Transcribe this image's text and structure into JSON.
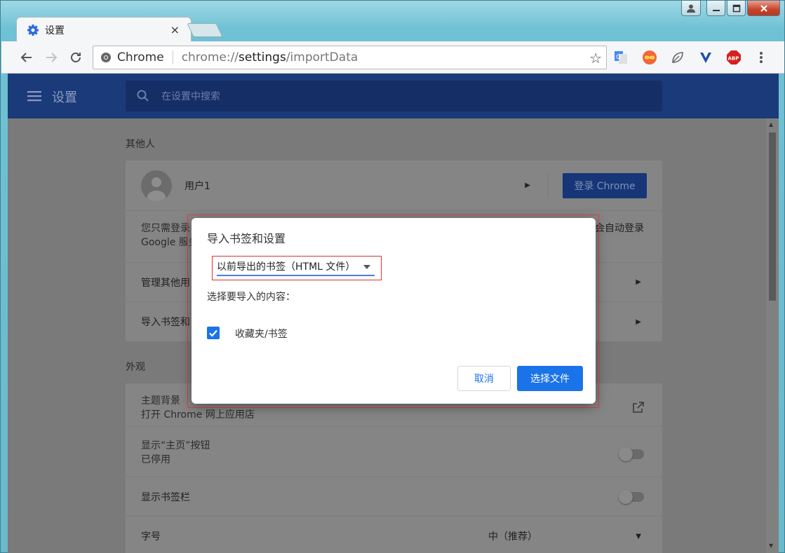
{
  "browser": {
    "tab_title": "设置",
    "tab_close": "×",
    "omnibox_chip": "Chrome",
    "url_scheme": "chrome://",
    "url_host": "settings",
    "url_path": "/importData"
  },
  "settings_header": {
    "title": "设置",
    "search_placeholder": "在设置中搜索"
  },
  "people_section": {
    "title": "其他人",
    "user_name": "用户1",
    "signin_button": "登录 Chrome",
    "sync_text_left_line1": "您只需登录",
    "sync_text_left_line2": "Google 服务",
    "sync_text_right": "会自动登录",
    "manage_label": "管理其他用",
    "import_label": "导入书签和"
  },
  "appearance_section": {
    "title": "外观",
    "theme_label": "主题背景",
    "theme_sub": "打开 Chrome 网上应用店",
    "home_label": "显示“主页”按钮",
    "home_sub": "已停用",
    "bookmarks_bar_label": "显示书签栏",
    "font_label": "字号",
    "font_value": "中（推荐）"
  },
  "dialog": {
    "title": "导入书签和设置",
    "source_selected": "以前导出的书签（HTML 文件）",
    "content_label": "选择要导入的内容：",
    "checkbox_label": "收藏夹/书签",
    "checkbox_checked": true,
    "cancel_button": "取消",
    "choose_button": "选择文件"
  },
  "colors": {
    "accent": "#1a73e8",
    "header": "#1b3a7a",
    "highlight": "#dd3333"
  }
}
